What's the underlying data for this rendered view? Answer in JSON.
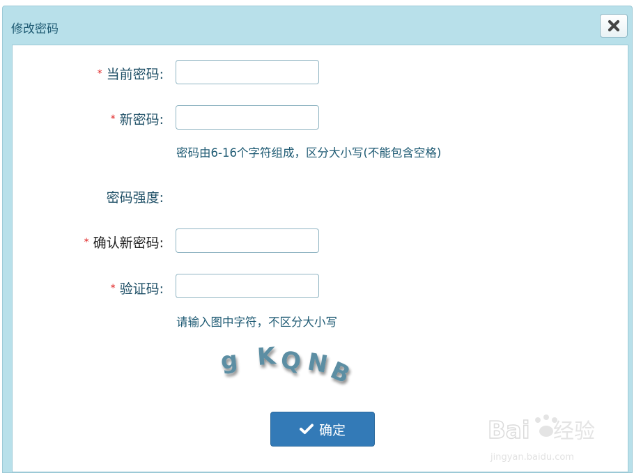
{
  "dialog": {
    "title": "修改密码",
    "close_icon": "close-x-icon"
  },
  "form": {
    "required_mark": "*",
    "current_password": {
      "label": "当前密码:",
      "value": ""
    },
    "new_password": {
      "label": "新密码:",
      "value": ""
    },
    "new_password_hint": "密码由6-16个字符组成，区分大小写(不能包含空格)",
    "strength_label": "密码强度:",
    "confirm_password": {
      "label": "确认新密码:",
      "value": ""
    },
    "captcha": {
      "label": "验证码:",
      "value": ""
    },
    "captcha_hint": "请输入图中字符，不区分大小写",
    "captcha_image_text": "gKQNB"
  },
  "actions": {
    "confirm_label": "确定",
    "confirm_icon": "check-icon"
  },
  "watermark": {
    "brand": "Baidu经验",
    "url": "jingyan.baidu.com"
  },
  "colors": {
    "titlebar": "#b8e0ea",
    "label": "#1e4f66",
    "required": "#e02020",
    "primary_button": "#337ab7"
  }
}
